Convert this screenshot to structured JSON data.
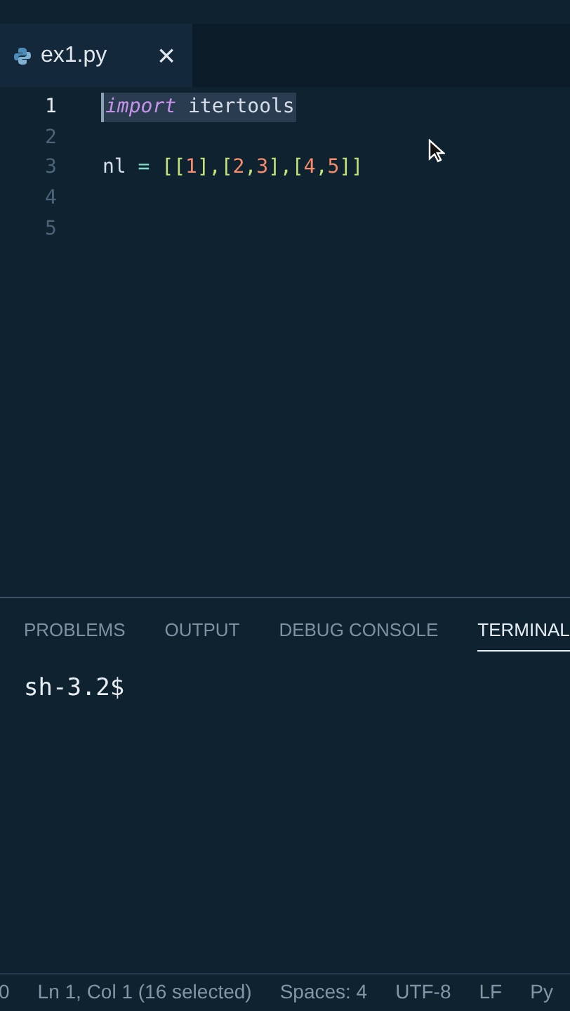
{
  "tabs": [
    {
      "label": "ex1.py",
      "selected": true,
      "close": "×"
    }
  ],
  "editor": {
    "lines": [
      {
        "number": "1",
        "selected": true,
        "tokens": [
          {
            "text": "import",
            "kind": "keyword"
          },
          {
            "text": " itertools",
            "kind": "plain"
          }
        ]
      },
      {
        "number": "2",
        "selected": false
      },
      {
        "number": "3",
        "selected": false,
        "tokens": [
          {
            "text": "nl ",
            "kind": "plain"
          },
          {
            "text": "=",
            "kind": "operator"
          },
          {
            "text": " [[",
            "kind": "bracket"
          },
          {
            "text": "1",
            "kind": "number"
          },
          {
            "text": "],[",
            "kind": "bracket"
          },
          {
            "text": "2",
            "kind": "number"
          },
          {
            "text": ",",
            "kind": "bracket"
          },
          {
            "text": "3",
            "kind": "number"
          },
          {
            "text": "],[",
            "kind": "bracket"
          },
          {
            "text": "4",
            "kind": "number"
          },
          {
            "text": ",",
            "kind": "bracket"
          },
          {
            "text": "5",
            "kind": "number"
          },
          {
            "text": "]]",
            "kind": "bracket"
          }
        ]
      },
      {
        "number": "4",
        "selected": false
      },
      {
        "number": "5",
        "selected": false
      }
    ]
  },
  "panel": {
    "tabs": [
      {
        "label": "PROBLEMS",
        "selected": false
      },
      {
        "label": "OUTPUT",
        "selected": false
      },
      {
        "label": "DEBUG CONSOLE",
        "selected": false
      },
      {
        "label": "TERMINAL",
        "selected": true
      }
    ],
    "terminal": {
      "prompt": "sh-3.2$"
    }
  },
  "status_bar": {
    "items": [
      "0",
      "Ln 1, Col 1 (16 selected)",
      "Spaces: 4",
      "UTF-8",
      "LF",
      "Py"
    ]
  }
}
